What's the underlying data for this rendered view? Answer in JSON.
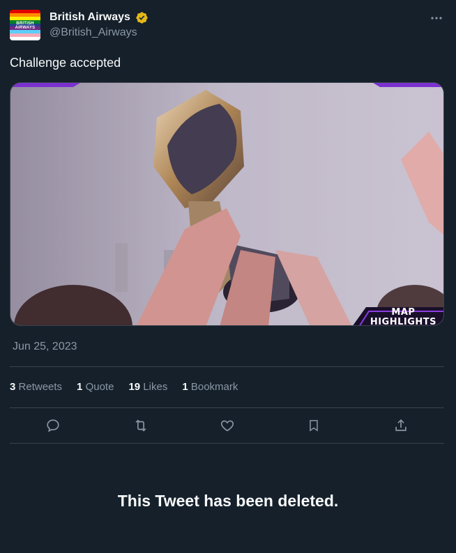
{
  "author": {
    "display_name": "British Airways",
    "handle": "@British_Airways",
    "verified_color": "#e2b719",
    "avatar_text": "BRITISH AIRWAYS",
    "avatar_icon": "pride-flag-logo"
  },
  "tweet": {
    "text": "Challenge accepted",
    "timestamp": "Jun 25, 2023",
    "media_overlay_line1": "MAP",
    "media_overlay_line2": "HIGHLIGHTS"
  },
  "stats": [
    {
      "count": "3",
      "label": "Retweets"
    },
    {
      "count": "1",
      "label": "Quote"
    },
    {
      "count": "19",
      "label": "Likes"
    },
    {
      "count": "1",
      "label": "Bookmark"
    }
  ],
  "actions": [
    "reply-icon",
    "retweet-icon",
    "like-icon",
    "bookmark-icon",
    "share-icon"
  ],
  "deleted_notice": "This Tweet has been deleted.",
  "colors": {
    "background": "#15202b",
    "text_primary": "#f7f9f9",
    "text_secondary": "#8b98a5",
    "divider": "#38444d"
  }
}
